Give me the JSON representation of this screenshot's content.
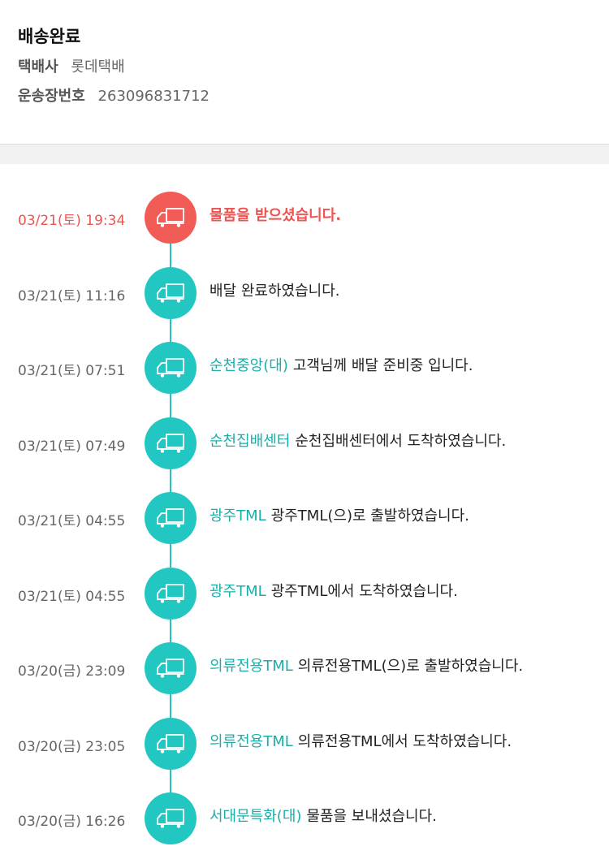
{
  "status_title": "배송완료",
  "carrier": {
    "label": "택배사",
    "value": "롯데택배"
  },
  "tracking": {
    "label": "운송장번호",
    "value": "263096831712"
  },
  "colors": {
    "accent": "#22c7c2",
    "active": "#f25c57",
    "location_text": "#1aaea9"
  },
  "events": [
    {
      "time": "03/21(토) 19:34",
      "location": "",
      "message": "물품을 받으셨습니다.",
      "icon": "truck-icon",
      "active": true
    },
    {
      "time": "03/21(토) 11:16",
      "location": "",
      "message": "배달 완료하였습니다.",
      "icon": "truck-icon",
      "active": false
    },
    {
      "time": "03/21(토) 07:51",
      "location": "순천중앙(대)",
      "message": "고객님께 배달 준비중 입니다.",
      "icon": "truck-icon",
      "active": false
    },
    {
      "time": "03/21(토) 07:49",
      "location": "순천집배센터",
      "message": "순천집배센터에서 도착하였습니다.",
      "icon": "truck-icon",
      "active": false
    },
    {
      "time": "03/21(토) 04:55",
      "location": "광주TML",
      "message": "광주TML(으)로 출발하였습니다.",
      "icon": "truck-icon",
      "active": false
    },
    {
      "time": "03/21(토) 04:55",
      "location": "광주TML",
      "message": "광주TML에서 도착하였습니다.",
      "icon": "truck-icon",
      "active": false
    },
    {
      "time": "03/20(금) 23:09",
      "location": "의류전용TML",
      "message": "의류전용TML(으)로 출발하였습니다.",
      "icon": "truck-icon",
      "active": false
    },
    {
      "time": "03/20(금) 23:05",
      "location": "의류전용TML",
      "message": "의류전용TML에서 도착하였습니다.",
      "icon": "truck-icon",
      "active": false
    },
    {
      "time": "03/20(금) 16:26",
      "location": "서대문특화(대)",
      "message": "물품을 보내셨습니다.",
      "icon": "truck-icon",
      "active": false
    }
  ]
}
